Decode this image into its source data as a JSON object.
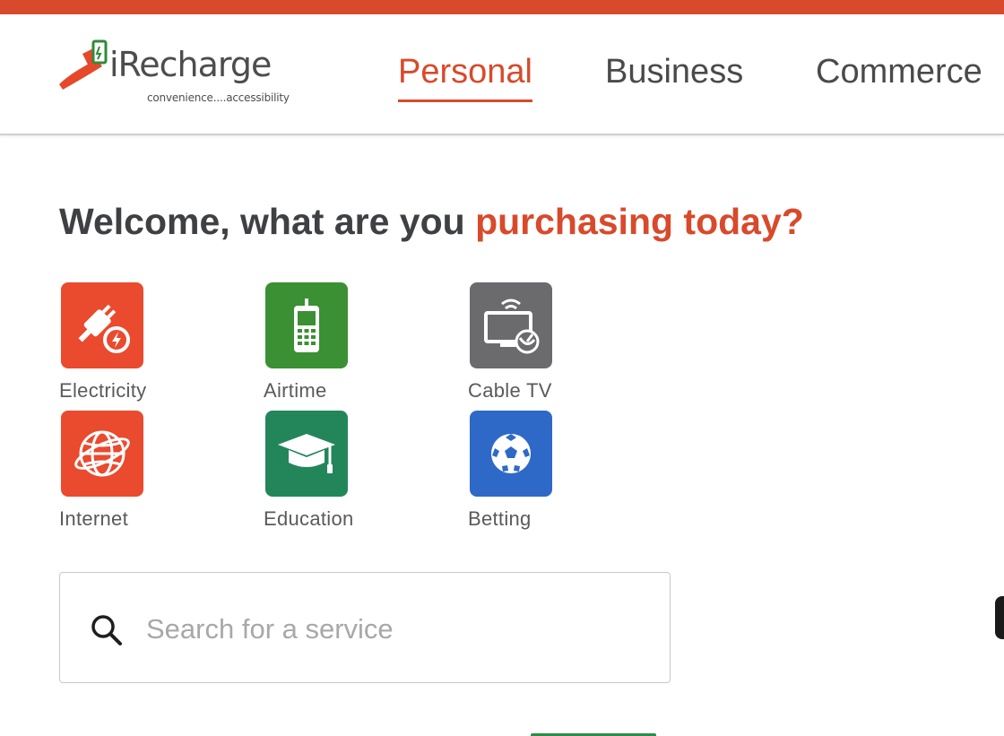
{
  "header": {
    "logo": {
      "name": "iRecharge",
      "tagline": "convenience....accessibility"
    },
    "tabs": [
      {
        "label": "Personal",
        "active": true
      },
      {
        "label": "Business",
        "active": false
      },
      {
        "label": "Commerce",
        "active": false
      }
    ]
  },
  "main": {
    "welcome_prefix": "Welcome, what are you ",
    "welcome_accent": "purchasing today?",
    "services": [
      {
        "label": "Electricity",
        "icon": "plug-bolt-icon",
        "color": "#ea4a2e"
      },
      {
        "label": "Airtime",
        "icon": "mobile-phone-icon",
        "color": "#3a9033"
      },
      {
        "label": "Cable TV",
        "icon": "tv-satellite-icon",
        "color": "#6b6b6e"
      },
      {
        "label": "Internet",
        "icon": "globe-icon",
        "color": "#ea4a2e"
      },
      {
        "label": "Education",
        "icon": "graduation-cap-icon",
        "color": "#23865a"
      },
      {
        "label": "Betting",
        "icon": "soccer-ball-icon",
        "color": "#2f69c8"
      }
    ],
    "search": {
      "placeholder": "Search for a service",
      "value": ""
    }
  },
  "colors": {
    "accent": "#d84a2b",
    "text_dark": "#3e4043"
  }
}
